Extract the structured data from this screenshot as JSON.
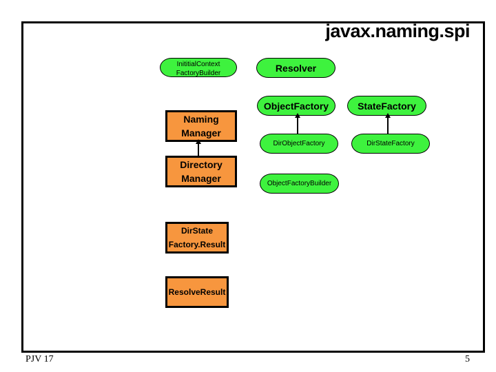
{
  "slide": {
    "title": "javax.naming.spi",
    "footer_left": "PJV 17",
    "page_number": "5"
  },
  "colors": {
    "interface_fill": "#3ef23e",
    "class_fill": "#f7963e",
    "outline": "#000000"
  },
  "interfaces": {
    "initial_context_factory_builder": {
      "line1": "InititialContext",
      "line2": "FactoryBuilder"
    },
    "resolver": "Resolver",
    "object_factory": "ObjectFactory",
    "state_factory": "StateFactory",
    "dir_object_factory": "DirObjectFactory",
    "dir_state_factory": "DirStateFactory",
    "object_factory_builder": "ObjectFactoryBuilder"
  },
  "classes": {
    "naming_manager": {
      "line1": "Naming",
      "line2": "Manager"
    },
    "directory_manager": {
      "line1": "Directory",
      "line2": "Manager"
    },
    "dir_state_factory_result": {
      "line1": "DirState",
      "line2": "Factory.Result"
    },
    "resolve_result": "ResolveResult"
  },
  "relations": [
    {
      "from": "DirectoryManager",
      "to": "NamingManager",
      "type": "extends"
    },
    {
      "from": "DirObjectFactory",
      "to": "ObjectFactory",
      "type": "extends"
    },
    {
      "from": "DirStateFactory",
      "to": "StateFactory",
      "type": "extends"
    }
  ]
}
